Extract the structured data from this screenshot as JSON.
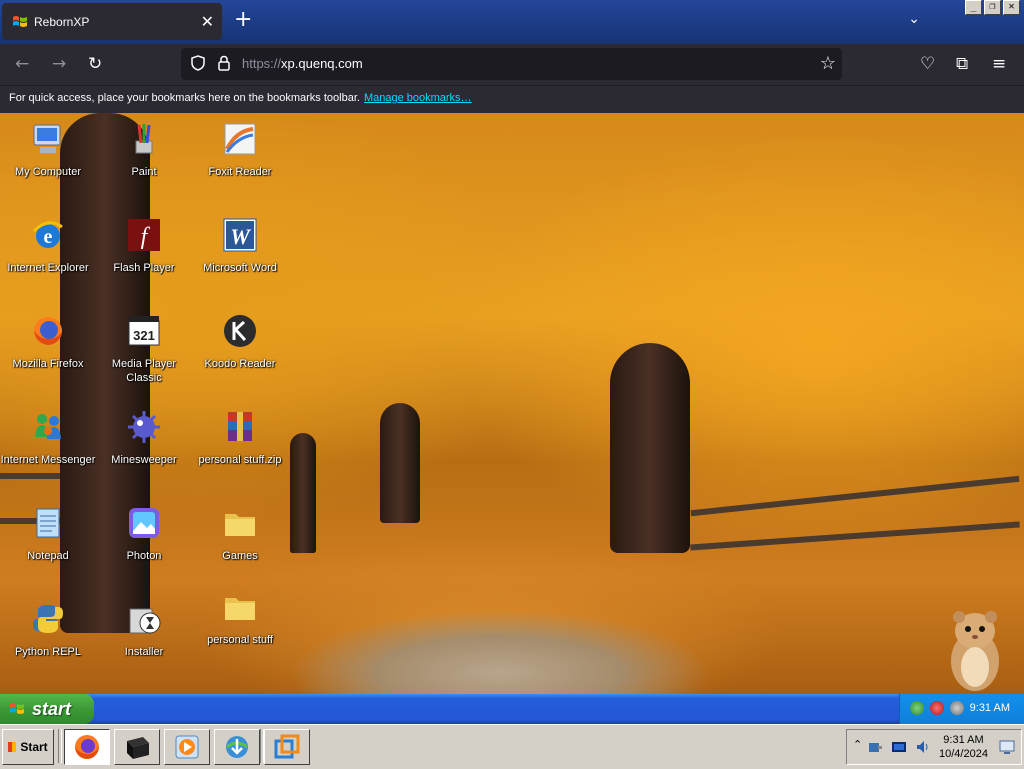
{
  "window_controls": {
    "minimize": "_",
    "restore": "❐",
    "close": "✕"
  },
  "tab": {
    "title": "RebornXP",
    "close": "✕"
  },
  "tabbar": {
    "new_tab": "+",
    "list_all": "⌄"
  },
  "navbar": {
    "back": "←",
    "forward": "→",
    "reload": "↻",
    "url_scheme": "https://",
    "url_host": "xp.quenq.com",
    "bookmark_star": "☆",
    "pocket": "♡",
    "extensions": "⧉",
    "menu": "≡"
  },
  "bookmarks_bar": {
    "message": "For quick access, place your bookmarks here on the bookmarks toolbar.",
    "link": "Manage bookmarks…"
  },
  "desktop": {
    "icons": [
      {
        "label": "My Computer",
        "icon": "computer-icon"
      },
      {
        "label": "Paint",
        "icon": "paint-icon"
      },
      {
        "label": "Foxit Reader",
        "icon": "foxit-reader-icon"
      },
      {
        "label": "Internet Explorer",
        "icon": "internet-explorer-icon"
      },
      {
        "label": "Flash Player",
        "icon": "flash-player-icon"
      },
      {
        "label": "Microsoft Word",
        "icon": "microsoft-word-icon"
      },
      {
        "label": "Mozilla Firefox",
        "icon": "firefox-icon"
      },
      {
        "label": "Media Player Classic",
        "icon": "media-player-classic-icon"
      },
      {
        "label": "Koodo Reader",
        "icon": "koodo-reader-icon"
      },
      {
        "label": "Internet Messenger",
        "icon": "messenger-icon"
      },
      {
        "label": "Minesweeper",
        "icon": "minesweeper-icon"
      },
      {
        "label": "personal stuff.zip",
        "icon": "winrar-archive-icon"
      },
      {
        "label": "Notepad",
        "icon": "notepad-icon"
      },
      {
        "label": "Photon",
        "icon": "photon-icon"
      },
      {
        "label": "Games",
        "icon": "folder-icon"
      },
      {
        "label": "Python REPL",
        "icon": "python-icon"
      },
      {
        "label": "Installer",
        "icon": "installer-icon"
      },
      {
        "label": "personal stuff",
        "icon": "folder-icon"
      }
    ]
  },
  "xp_taskbar": {
    "start_label": "start",
    "clock": "9:31 AM"
  },
  "host_taskbar": {
    "start_label": "Start",
    "quick_launch": [
      "firefox-icon",
      "terminal-icon",
      "media-player-icon",
      "download-manager-icon",
      "virtual-machine-icon"
    ],
    "tray_expand": "⌃",
    "time": "9:31 AM",
    "date": "10/4/2024"
  },
  "colors": {
    "browser_bg": "#2b2a33",
    "link": "#00ddff",
    "xp_blue": "#245edb",
    "xp_green": "#3c9a36"
  }
}
